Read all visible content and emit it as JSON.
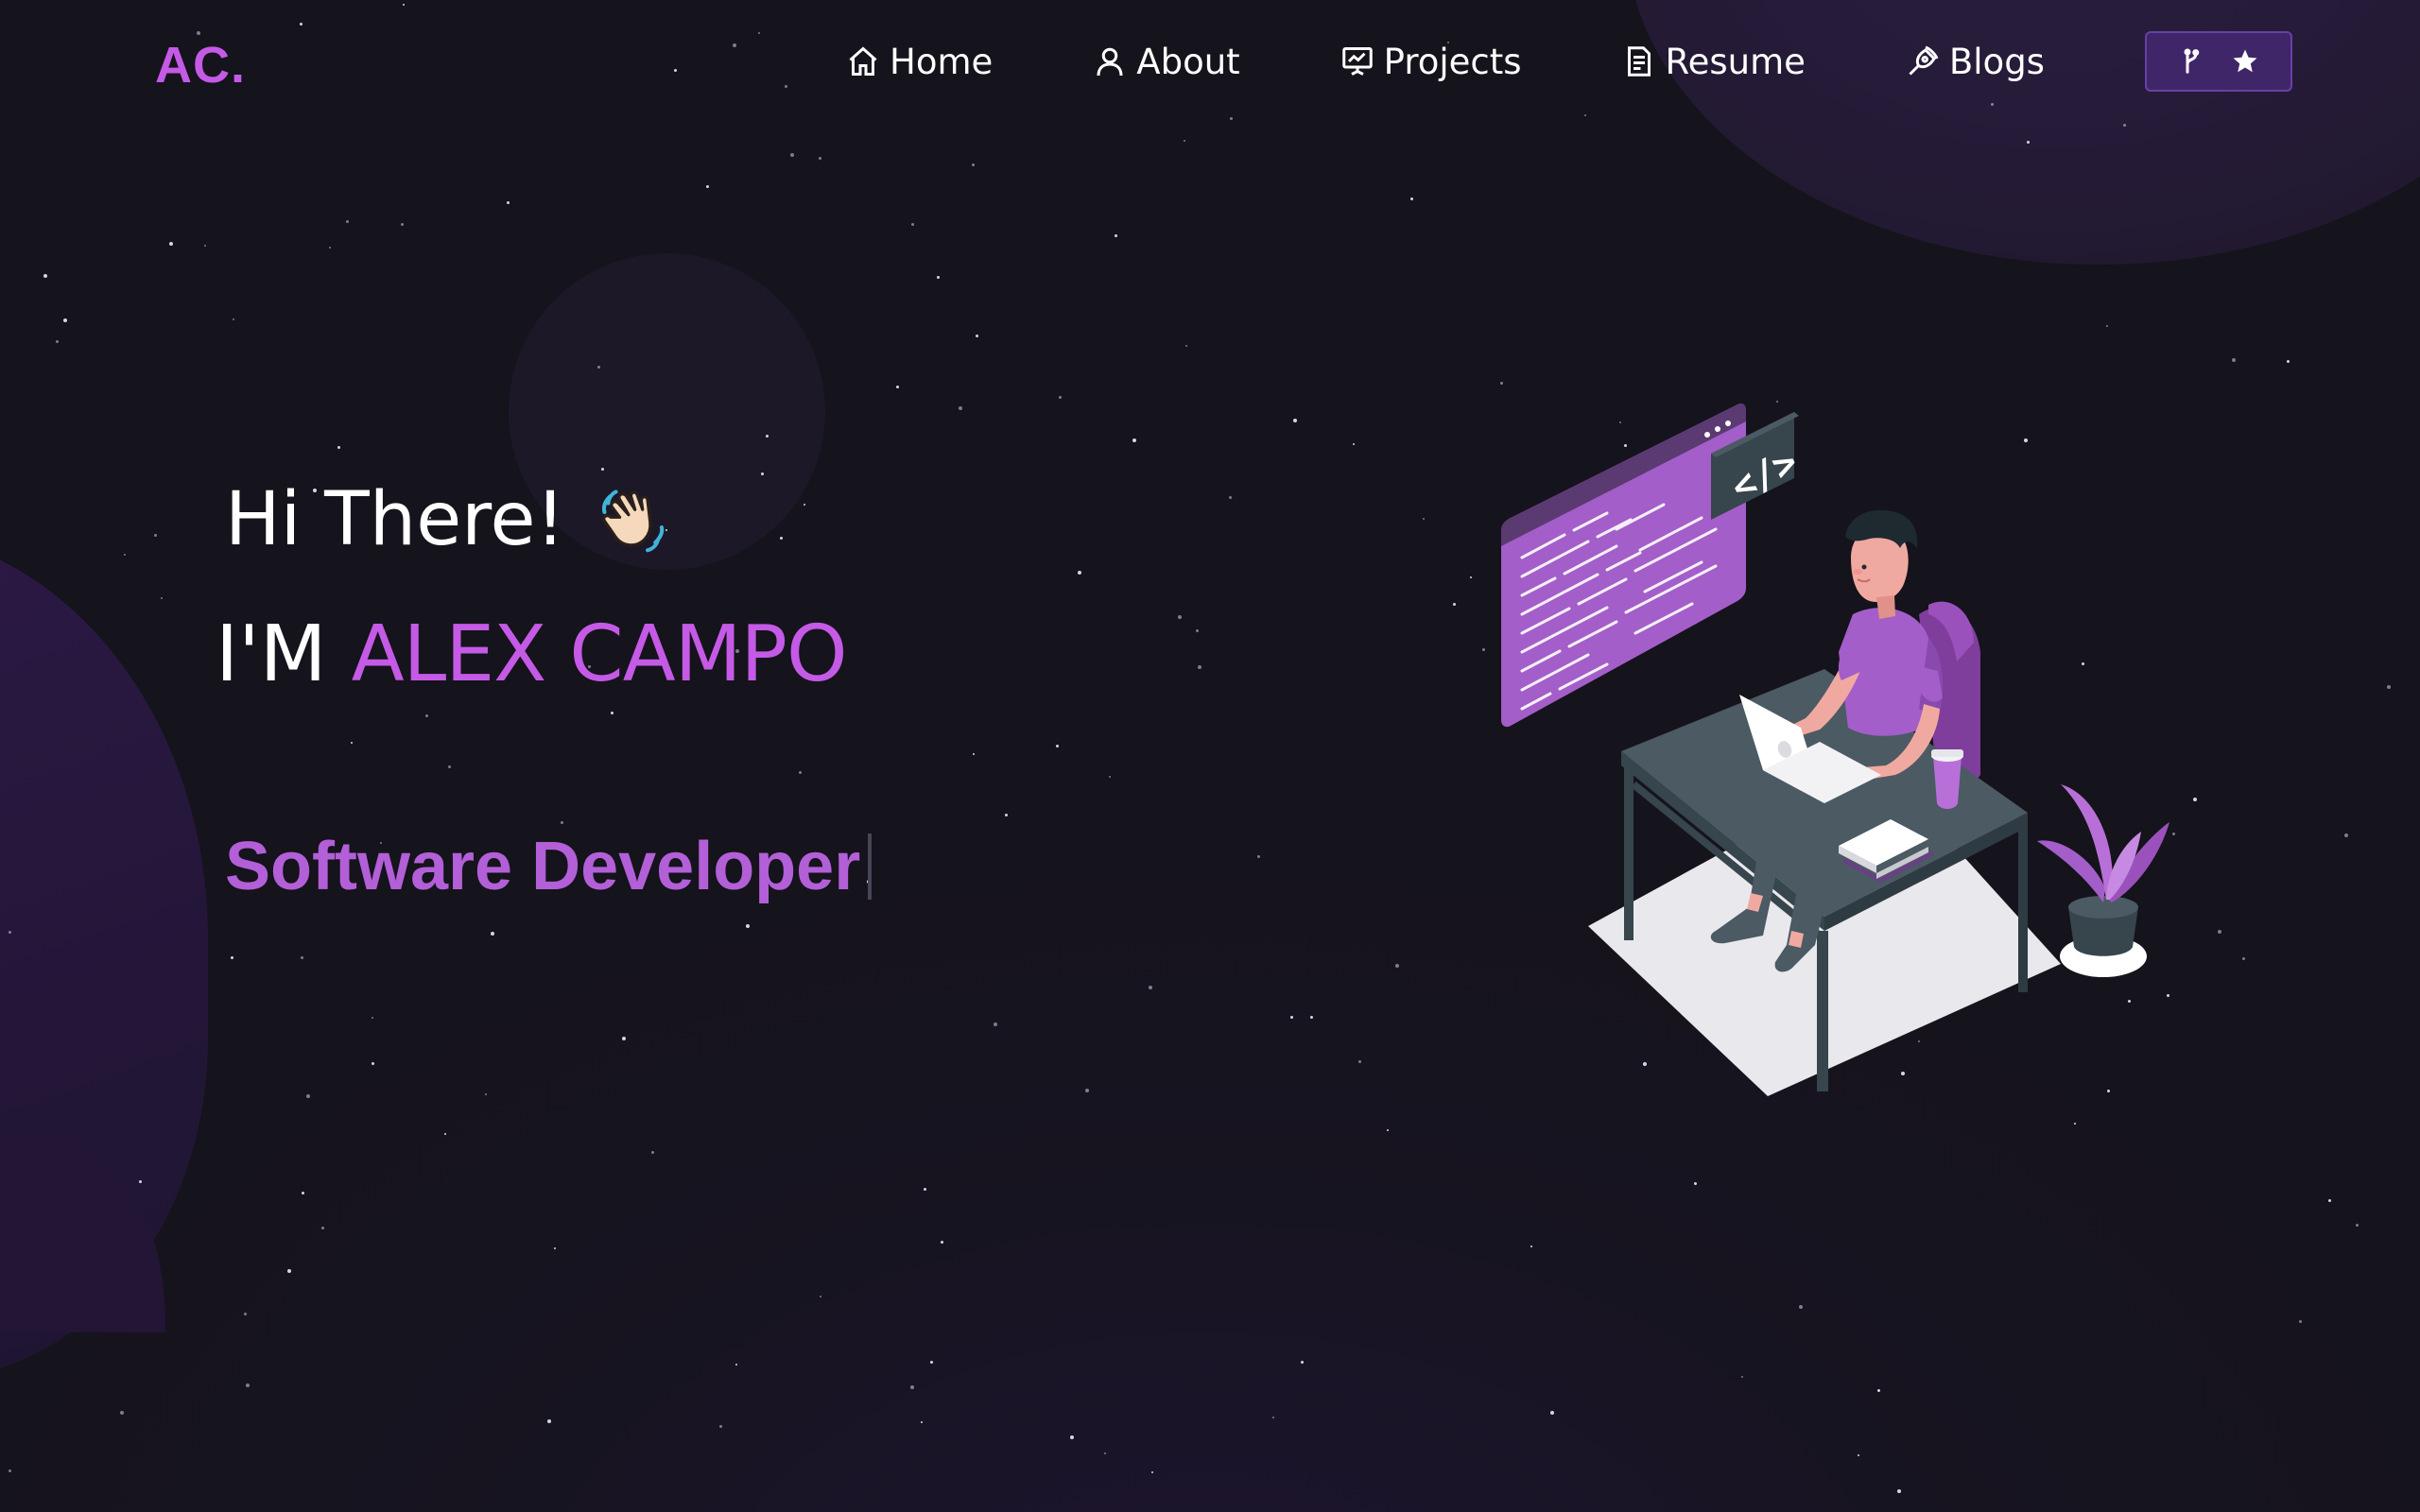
{
  "brand": {
    "logo": "AC."
  },
  "nav": {
    "items": [
      {
        "label": "Home",
        "icon": "home-icon"
      },
      {
        "label": "About",
        "icon": "user-icon"
      },
      {
        "label": "Projects",
        "icon": "presentation-icon"
      },
      {
        "label": "Resume",
        "icon": "document-icon"
      },
      {
        "label": "Blogs",
        "icon": "pen-nib-icon"
      }
    ],
    "github_button": {
      "icons": [
        "git-fork-icon",
        "star-icon"
      ]
    }
  },
  "hero": {
    "greeting": "Hi There!",
    "greeting_emoji": "waving-hand-emoji",
    "intro_prefix": "I'M",
    "name": "ALEX CAMPO",
    "role": "Software Developer"
  },
  "colors": {
    "background": "#17141f",
    "accent": "#c45ae6",
    "role_text": "#b25fd8",
    "button_bg": "#3f2668"
  }
}
